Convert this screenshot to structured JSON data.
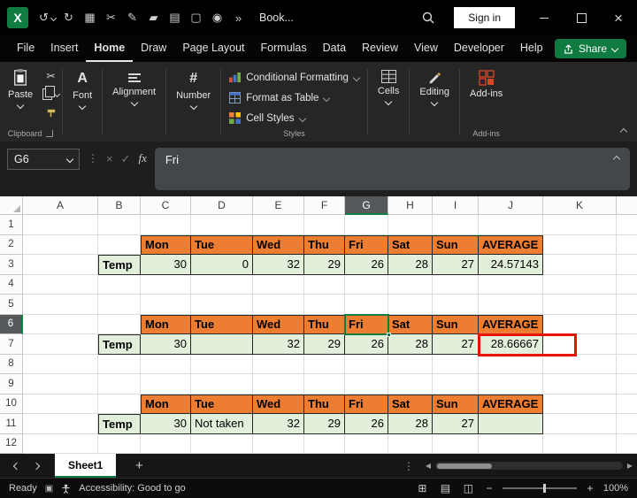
{
  "colors": {
    "accent_green": "#107C41",
    "header_orange": "#ED7D31",
    "cell_green": "#E2EFDA",
    "annotation_red": "#E51400"
  },
  "icon_glyphs": {
    "logo_letter": "X",
    "undo": "↺",
    "redo": "↻",
    "table": "▦",
    "cut": "✂",
    "pen": "✎",
    "highlight": "▰",
    "print": "▤",
    "document": "▢",
    "camera": "◉",
    "overflow": "»",
    "font_letter": "A",
    "number_hash": "#",
    "dots_vertical": "⋮",
    "scroll_left": "◀",
    "scroll_right": "▶",
    "view_normal": "⊞",
    "view_layout": "▤",
    "view_break": "◫",
    "zoom_minus": "−",
    "zoom_plus": "+",
    "close": "×",
    "check": "✓",
    "cancel": "×",
    "macro": "▣",
    "add_sheet": "+"
  },
  "titlebar": {
    "title": "Book...",
    "sign_in_label": "Sign in",
    "quick_access_icons": [
      "undo",
      "redo",
      "table",
      "cut",
      "pen",
      "highlight",
      "print",
      "document",
      "camera",
      "overflow"
    ]
  },
  "menubar": {
    "tabs": [
      "File",
      "Insert",
      "Home",
      "Draw",
      "Page Layout",
      "Formulas",
      "Data",
      "Review",
      "View",
      "Developer",
      "Help"
    ],
    "active_tab": "Home",
    "share_label": "Share"
  },
  "ribbon": {
    "paste_label": "Paste",
    "collapsed_groups": [
      "Font",
      "Alignment",
      "Number"
    ],
    "style_buttons": [
      "Conditional Formatting",
      "Format as Table",
      "Cell Styles"
    ],
    "right_groups": [
      "Cells",
      "Editing",
      "Add-ins"
    ],
    "group_labels": {
      "clipboard": "Clipboard",
      "styles": "Styles",
      "addins": "Add-ins"
    }
  },
  "formula_bar": {
    "name_box": "G6",
    "fx_label": "fx",
    "content": "Fri"
  },
  "grid": {
    "columns": [
      "A",
      "B",
      "C",
      "D",
      "E",
      "F",
      "G",
      "H",
      "I",
      "J",
      "K"
    ],
    "row_count": 12,
    "selection": {
      "cell": "G6",
      "column": "G",
      "row": 6
    },
    "red_box_cell": "J7",
    "cells": {
      "C2": {
        "t": "Mon",
        "s": "hdr"
      },
      "D2": {
        "t": "Tue",
        "s": "hdr"
      },
      "E2": {
        "t": "Wed",
        "s": "hdr"
      },
      "F2": {
        "t": "Thu",
        "s": "hdr"
      },
      "G2": {
        "t": "Fri",
        "s": "hdr"
      },
      "H2": {
        "t": "Sat",
        "s": "hdr"
      },
      "I2": {
        "t": "Sun",
        "s": "hdr"
      },
      "J2": {
        "t": "AVERAGE",
        "s": "hdr"
      },
      "B3": {
        "t": "Temp",
        "s": "lbl"
      },
      "C3": {
        "t": "30",
        "s": "num"
      },
      "D3": {
        "t": "0",
        "s": "num"
      },
      "E3": {
        "t": "32",
        "s": "num"
      },
      "F3": {
        "t": "29",
        "s": "num"
      },
      "G3": {
        "t": "26",
        "s": "num"
      },
      "H3": {
        "t": "28",
        "s": "num"
      },
      "I3": {
        "t": "27",
        "s": "num"
      },
      "J3": {
        "t": "24.57143",
        "s": "num"
      },
      "C6": {
        "t": "Mon",
        "s": "hdr"
      },
      "D6": {
        "t": "Tue",
        "s": "hdr"
      },
      "E6": {
        "t": "Wed",
        "s": "hdr"
      },
      "F6": {
        "t": "Thu",
        "s": "hdr"
      },
      "G6": {
        "t": "Fri",
        "s": "hdr"
      },
      "H6": {
        "t": "Sat",
        "s": "hdr"
      },
      "I6": {
        "t": "Sun",
        "s": "hdr"
      },
      "J6": {
        "t": "AVERAGE",
        "s": "hdr"
      },
      "B7": {
        "t": "Temp",
        "s": "lbl"
      },
      "C7": {
        "t": "30",
        "s": "num"
      },
      "D7": {
        "t": "",
        "s": "fill"
      },
      "E7": {
        "t": "32",
        "s": "num"
      },
      "F7": {
        "t": "29",
        "s": "num"
      },
      "G7": {
        "t": "26",
        "s": "num"
      },
      "H7": {
        "t": "28",
        "s": "num"
      },
      "I7": {
        "t": "27",
        "s": "num"
      },
      "J7": {
        "t": "28.66667",
        "s": "num"
      },
      "C10": {
        "t": "Mon",
        "s": "hdr"
      },
      "D10": {
        "t": "Tue",
        "s": "hdr"
      },
      "E10": {
        "t": "Wed",
        "s": "hdr"
      },
      "F10": {
        "t": "Thu",
        "s": "hdr"
      },
      "G10": {
        "t": "Fri",
        "s": "hdr"
      },
      "H10": {
        "t": "Sat",
        "s": "hdr"
      },
      "I10": {
        "t": "Sun",
        "s": "hdr"
      },
      "J10": {
        "t": "AVERAGE",
        "s": "hdr"
      },
      "B11": {
        "t": "Temp",
        "s": "lbl"
      },
      "C11": {
        "t": "30",
        "s": "num"
      },
      "D11": {
        "t": "Not taken",
        "s": "txt"
      },
      "E11": {
        "t": "32",
        "s": "num"
      },
      "F11": {
        "t": "29",
        "s": "num"
      },
      "G11": {
        "t": "26",
        "s": "num"
      },
      "H11": {
        "t": "28",
        "s": "num"
      },
      "I11": {
        "t": "27",
        "s": "num"
      },
      "J11": {
        "t": "",
        "s": "fill"
      }
    }
  },
  "sheet_tabs": {
    "active_tab": "Sheet1"
  },
  "status_bar": {
    "mode": "Ready",
    "accessibility": "Accessibility: Good to go",
    "zoom": "100%"
  }
}
